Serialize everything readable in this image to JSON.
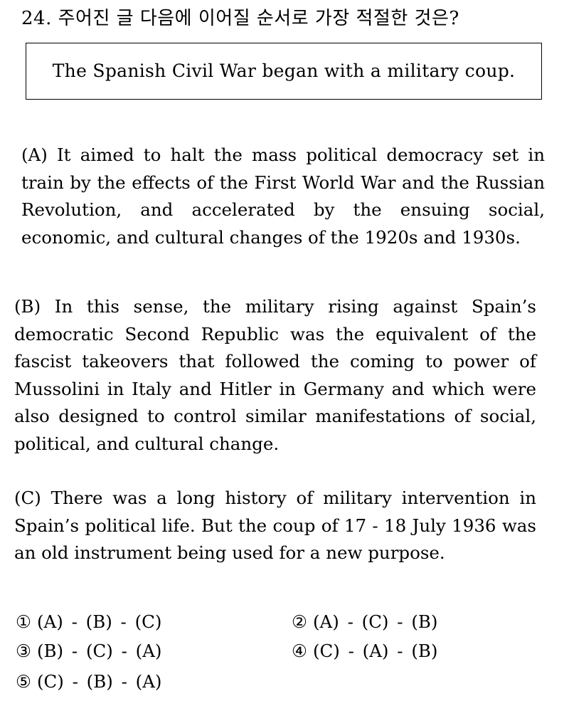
{
  "question": {
    "title": "24. 주어진 글 다음에 이어질 순서로 가장 적절한 것은?"
  },
  "given_sentence": "The Spanish Civil War began with a military coup.",
  "paragraphs": [
    {
      "text": "(A) It aimed to halt the mass political democracy set in train by the effects of the First World War and the Russian Revolution, and accelerated by the ensuing social, economic, and cultural changes of the 1920s and 1930s."
    },
    {
      "text": "(B) In this sense, the military rising against Spain’s democratic Second Republic was the equivalent of the fascist takeovers that followed the coming to power of Mussolini in Italy and Hitler in Germany and which were also designed to control similar manifestations of social, political, and cultural change."
    },
    {
      "text": "(C) There was a long history of military intervention in Spain’s political life. But the coup of 17 - 18 July 1936 was an old instrument being used for a new purpose."
    }
  ],
  "options": [
    {
      "number": "①",
      "text": "(A) - (B) - (C)"
    },
    {
      "number": "②",
      "text": "(A) - (C) - (B)"
    },
    {
      "number": "③",
      "text": "(B) - (C) - (A)"
    },
    {
      "number": "④",
      "text": "(C) - (A) - (B)"
    },
    {
      "number": "⑤",
      "text": "(C) - (B) - (A)"
    }
  ]
}
